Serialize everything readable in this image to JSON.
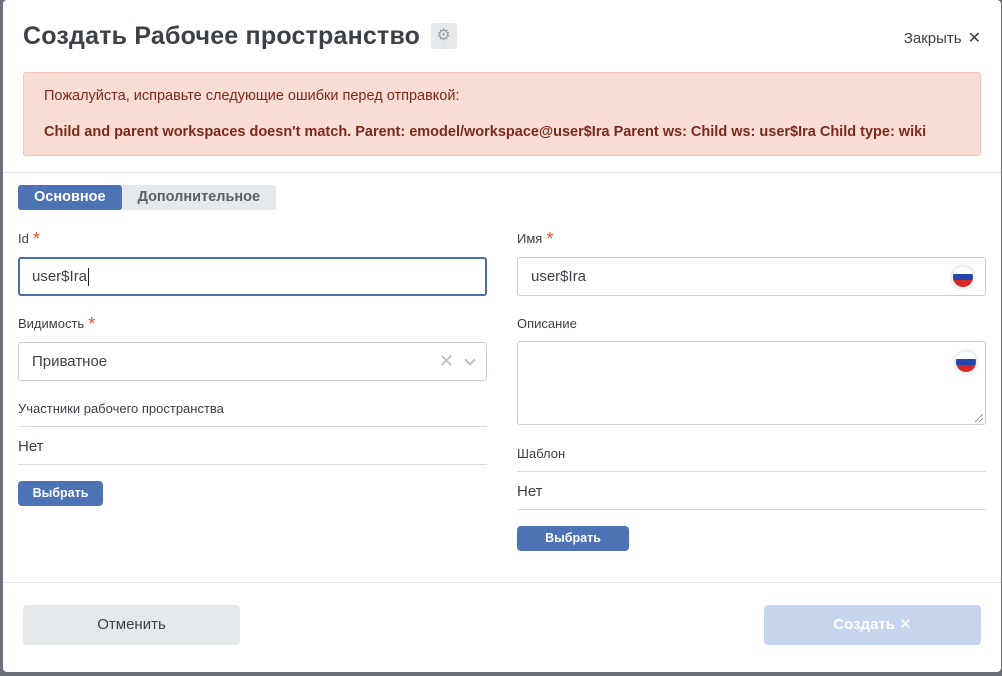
{
  "header": {
    "title": "Создать Рабочее пространство",
    "close_label": "Закрыть",
    "close_symbol": "✕"
  },
  "alert": {
    "intro": "Пожалуйста, исправьте следующие ошибки перед отправкой:",
    "error": "Child and parent workspaces doesn't match. Parent: emodel/workspace@user$Ira Parent ws: Child ws: user$Ira Child type: wiki"
  },
  "tabs": [
    {
      "label": "Основное",
      "active": true
    },
    {
      "label": "Дополнительное",
      "active": false
    }
  ],
  "form": {
    "id": {
      "label": "Id",
      "value": "user$Ira",
      "required_mark": "*"
    },
    "name": {
      "label": "Имя",
      "value": "user$Ira",
      "required_mark": "*"
    },
    "visibility": {
      "label": "Видимость",
      "value": "Приватное",
      "required_mark": "*"
    },
    "description": {
      "label": "Описание",
      "value": ""
    },
    "members": {
      "label": "Участники рабочего пространства",
      "value": "Нет",
      "button": "Выбрать"
    },
    "template": {
      "label": "Шаблон",
      "value": "Нет",
      "button": "Выбрать"
    }
  },
  "footer": {
    "cancel_label": "Отменить",
    "create_label": "Создать",
    "create_symbol": "✕"
  },
  "colors": {
    "accent": "#4d73b5",
    "alert_bg": "#f9dcd4",
    "alert_text": "#7a2a1b",
    "required": "#e2572c"
  }
}
